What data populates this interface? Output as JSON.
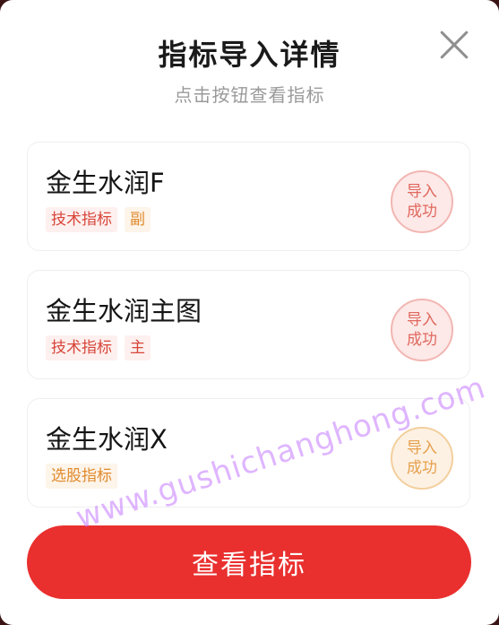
{
  "dialog": {
    "title": "指标导入详情",
    "subtitle": "点击按钮查看指标"
  },
  "items": [
    {
      "name": "金生水润F",
      "tags": [
        "技术指标",
        "副"
      ],
      "status": "导入\n成功"
    },
    {
      "name": "金生水润主图",
      "tags": [
        "技术指标",
        "主"
      ],
      "status": "导入\n成功"
    },
    {
      "name": "金生水润X",
      "tags": [
        "选股指标"
      ],
      "status": "导入\n成功"
    }
  ],
  "action": {
    "view_label": "查看指标"
  },
  "watermark": "www.gushichanghong.com",
  "colors": {
    "accent": "#e9302f",
    "tag_red_text": "#d8453a",
    "tag_orange_text": "#e08a2c",
    "stamp_red": "#e0685e",
    "stamp_orange": "#e6a04c"
  }
}
